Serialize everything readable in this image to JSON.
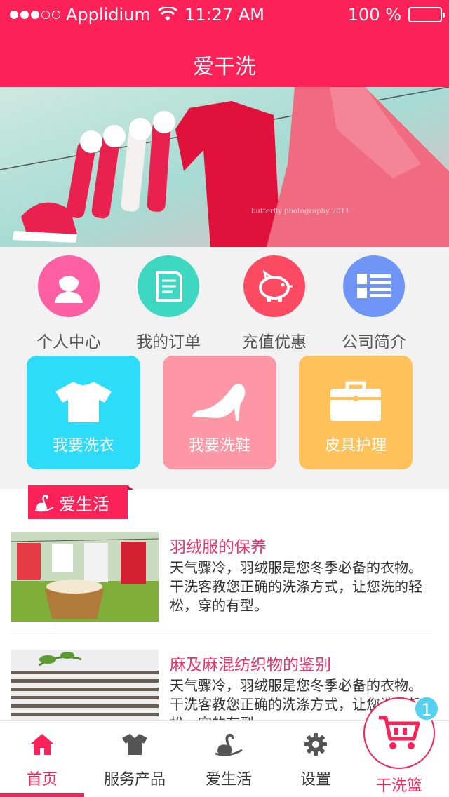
{
  "status_bar": {
    "carrier": "Applidium",
    "time": "11:27  AM",
    "battery": "100 %"
  },
  "header": {
    "title": "爱干洗"
  },
  "banner": {
    "watermark": "butterfly photography 2011"
  },
  "quick_menu": [
    {
      "label": "个人中心",
      "icon": "person-icon",
      "color": "#fd5fa3"
    },
    {
      "label": "我的订单",
      "icon": "document-icon",
      "color": "#3dd7c2"
    },
    {
      "label": "充值优惠",
      "icon": "piggy-bank-icon",
      "color": "#fc4a63"
    },
    {
      "label": "公司简介",
      "icon": "list-icon",
      "color": "#6f96f6"
    }
  ],
  "services": [
    {
      "label": "我要洗衣",
      "icon": "tshirt-icon",
      "color": "#2ddcf8"
    },
    {
      "label": "我要洗鞋",
      "icon": "high-heel-icon",
      "color": "#fd97a6"
    },
    {
      "label": "皮具护理",
      "icon": "briefcase-icon",
      "color": "#ffc15a"
    }
  ],
  "section": {
    "title": "爱生活"
  },
  "articles": [
    {
      "title": "羽绒服的保养",
      "body": "天气骤冷，羽绒服是您冬季必备的衣物。干洗客教您正确的洗涤方式，让您洗的轻松，穿的有型。"
    },
    {
      "title": "麻及麻混纺织物的鉴别",
      "body": "天气骤冷，羽绒服是您冬季必备的衣物。干洗客教您正确的洗涤方式，让您洗的轻松，穿的有型。"
    }
  ],
  "tabbar": {
    "tabs": [
      {
        "label": "首页",
        "icon": "home-icon",
        "active": true
      },
      {
        "label": "服务产品",
        "icon": "shirt-icon"
      },
      {
        "label": "爱生活",
        "icon": "swan-icon"
      },
      {
        "label": "设置",
        "icon": "gear-icon"
      }
    ],
    "cart": {
      "label": "干洗篮",
      "count": "1",
      "icon": "cart-icon"
    }
  },
  "colors": {
    "brand": "#fc2157",
    "accent_badge": "#55d0f0"
  }
}
